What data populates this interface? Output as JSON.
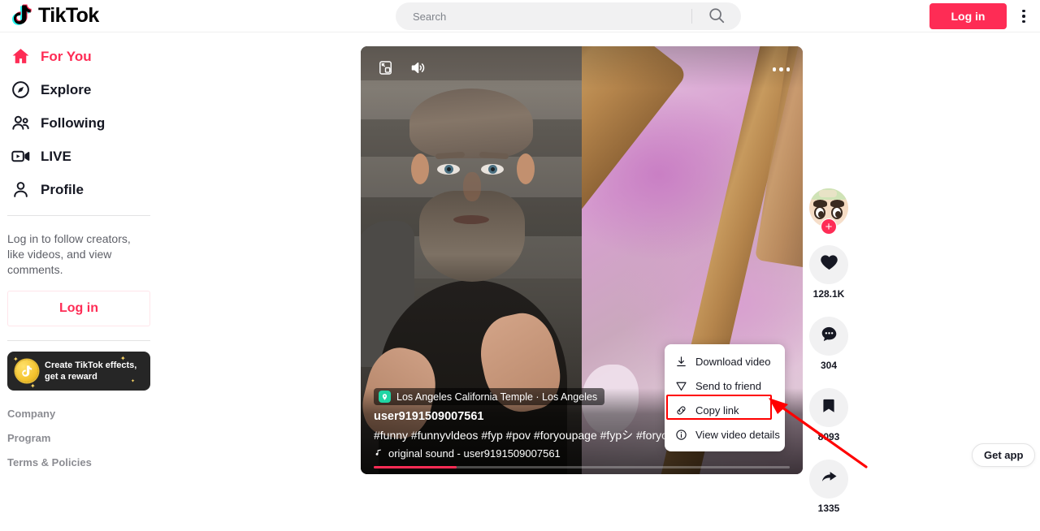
{
  "app": {
    "name": "TikTok",
    "brand_color": "#fe2c55"
  },
  "topnav": {
    "logo_text": "TikTok",
    "search": {
      "placeholder": "Search",
      "value": ""
    },
    "login_label": "Log in",
    "kebab_name": "more-options"
  },
  "sidebar": {
    "items": [
      {
        "label": "For You",
        "icon": "home-icon",
        "active": true
      },
      {
        "label": "Explore",
        "icon": "compass-icon",
        "active": false
      },
      {
        "label": "Following",
        "icon": "people-icon",
        "active": false
      },
      {
        "label": "LIVE",
        "icon": "live-video-icon",
        "active": false
      },
      {
        "label": "Profile",
        "icon": "person-icon",
        "active": false
      }
    ],
    "login_prompt": "Log in to follow creators, like videos, and view comments.",
    "login_label": "Log in",
    "promo": {
      "line1": "Create TikTok effects,",
      "line2": "get a reward"
    },
    "footer_links": [
      {
        "label": "Company"
      },
      {
        "label": "Program"
      },
      {
        "label": "Terms & Policies"
      }
    ]
  },
  "video": {
    "controls": {
      "fullscreen_icon": "picture-in-picture-icon",
      "volume_icon": "volume-on-icon",
      "more_icon": "more-dots-icon"
    },
    "location": "Los Angeles California Temple · Los Angeles",
    "username": "user9191509007561",
    "hashtags": "#funny #funnyvldeos #fyp #pov #foryoupage #fypシ #foryou",
    "music": "original sound - user9191509007561",
    "progress_percent": 20
  },
  "actions": [
    {
      "name": "like",
      "icon": "heart-icon",
      "count": "128.1K"
    },
    {
      "name": "comment",
      "icon": "comment-icon",
      "count": "304"
    },
    {
      "name": "bookmark",
      "icon": "bookmark-icon",
      "count": "8093"
    },
    {
      "name": "share",
      "icon": "share-arrow-icon",
      "count": "1335"
    }
  ],
  "context_menu": {
    "items": [
      {
        "label": "Download video",
        "icon": "download-icon",
        "highlighted": false
      },
      {
        "label": "Send to friend",
        "icon": "send-icon",
        "highlighted": false
      },
      {
        "label": "Copy link",
        "icon": "link-icon",
        "highlighted": true
      },
      {
        "label": "View video details",
        "icon": "info-icon",
        "highlighted": false
      }
    ],
    "highlight_color": "#ff0000"
  },
  "getapp": {
    "label": "Get app"
  }
}
